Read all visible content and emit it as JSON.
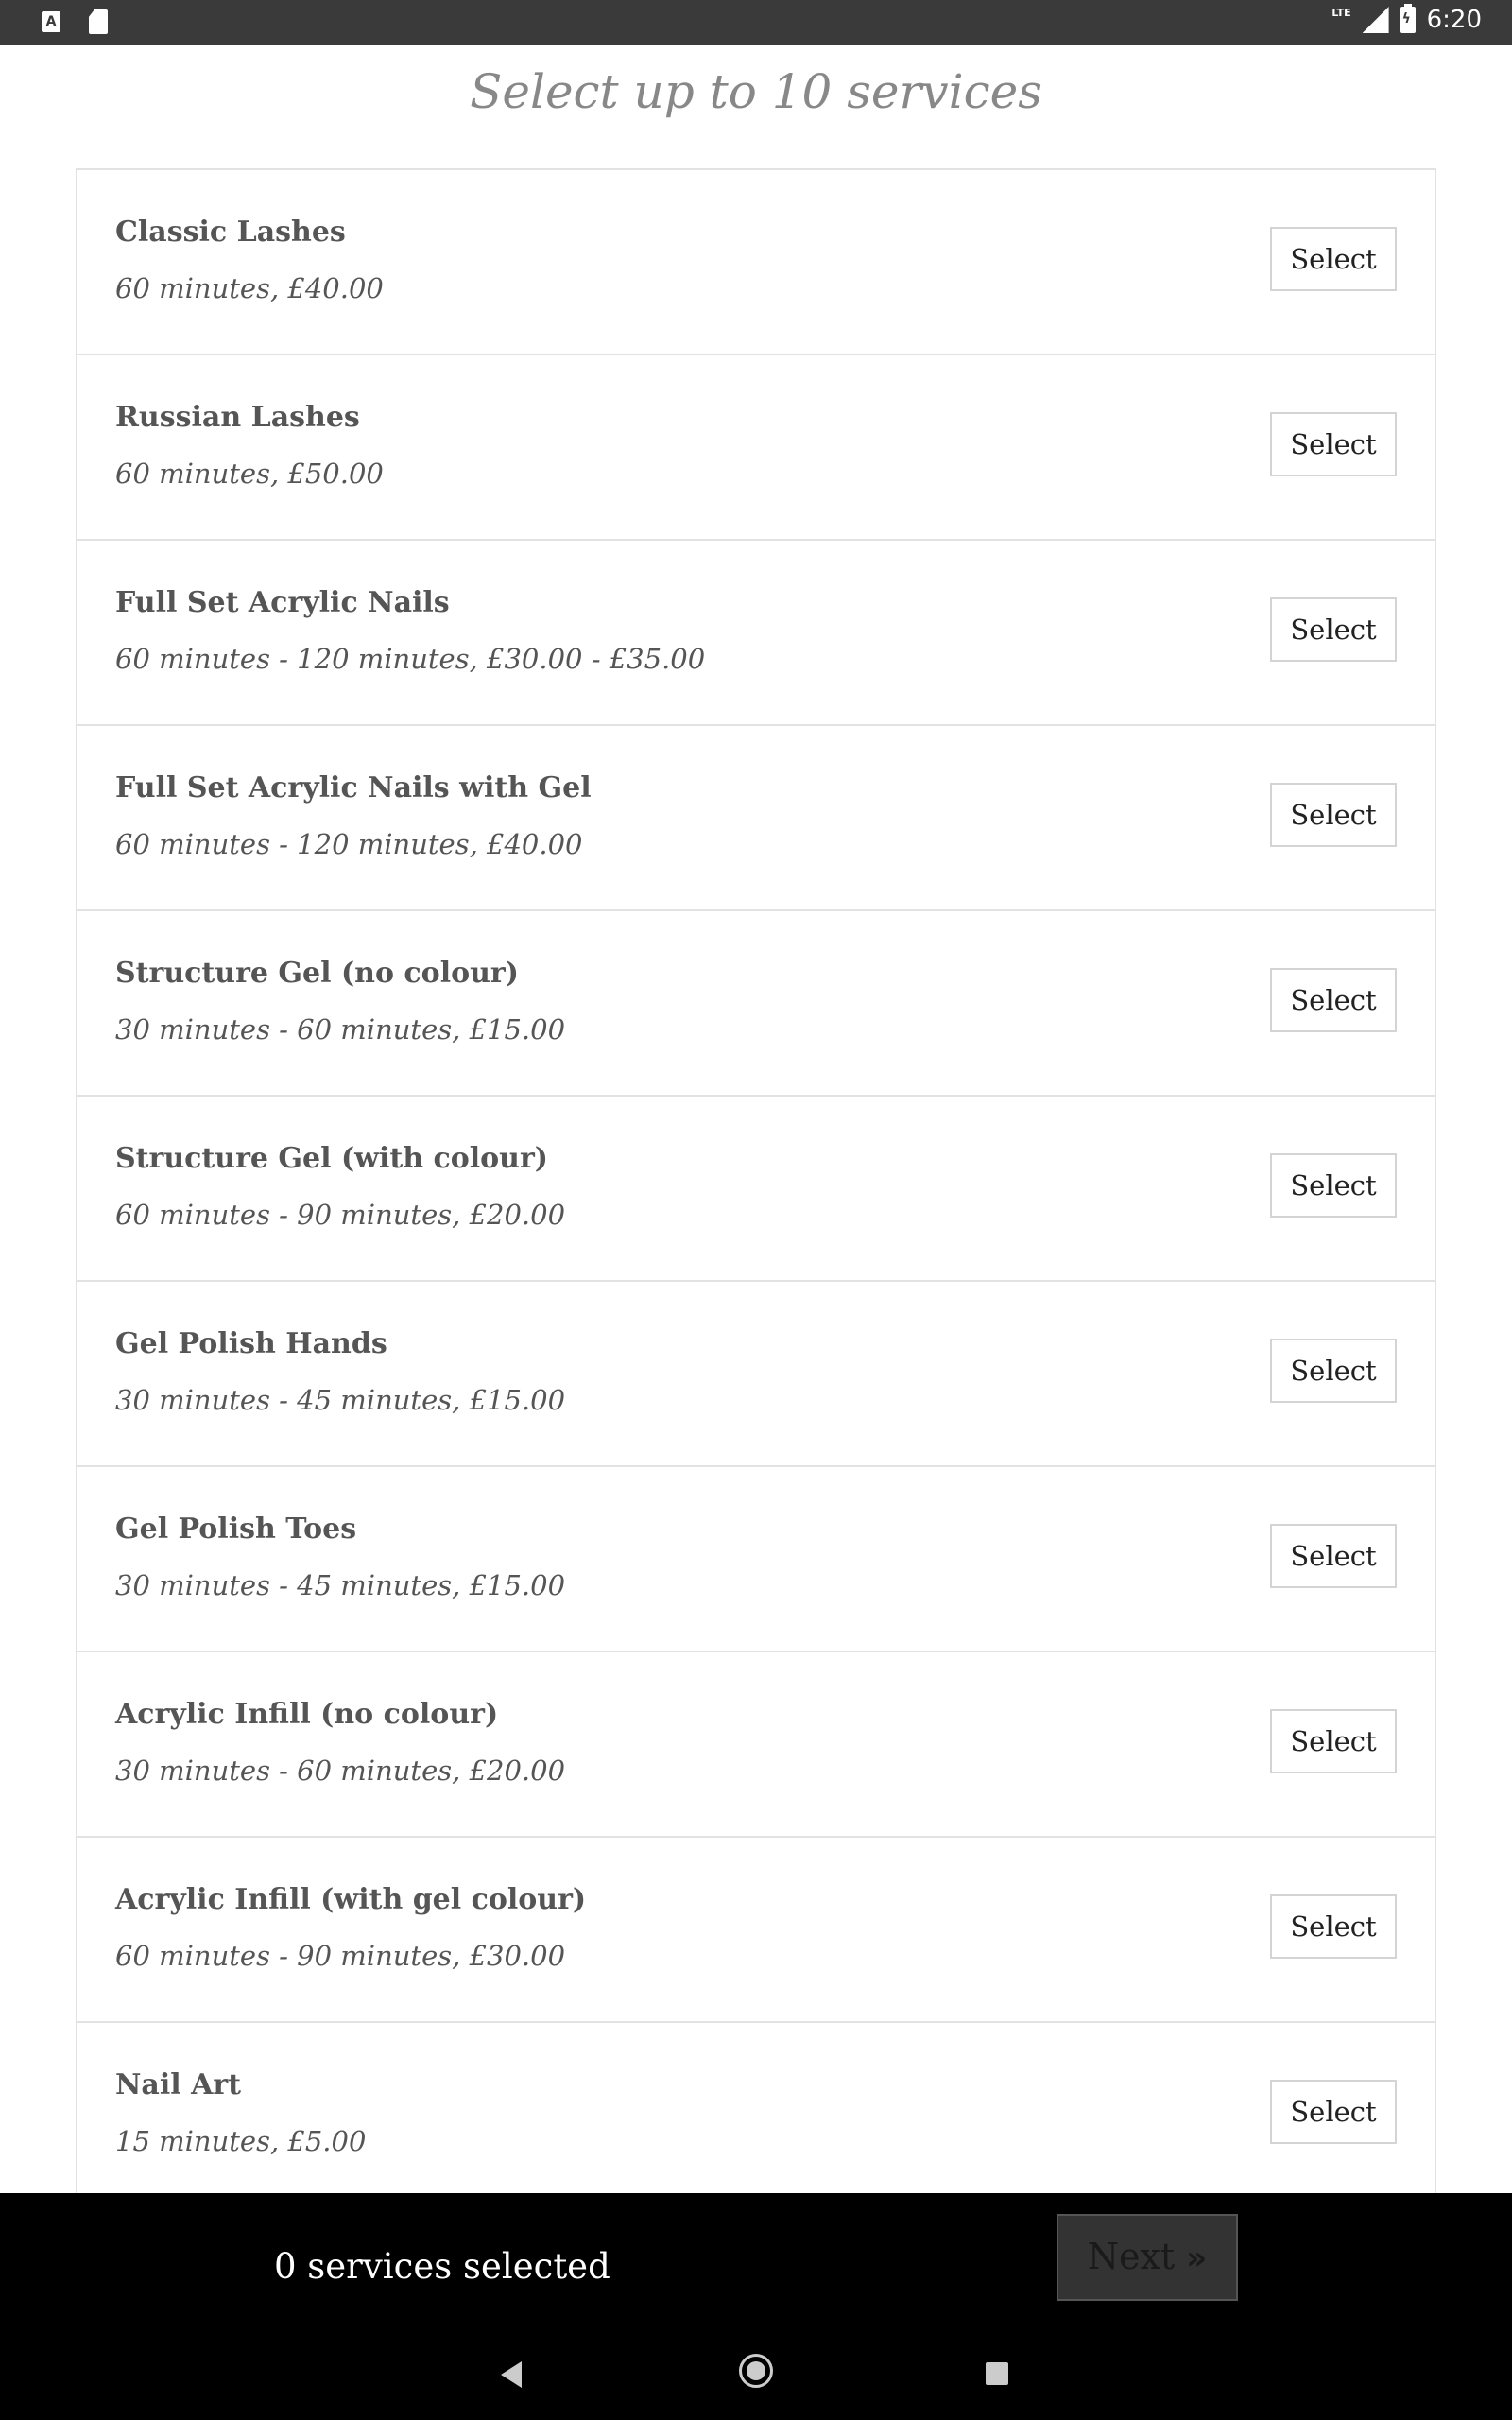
{
  "status_bar": {
    "notification_a": "A",
    "network_type": "LTE",
    "time": "6:20",
    "icons": [
      "notification-a-icon",
      "sd-card-icon",
      "signal-icon",
      "battery-charging-icon"
    ]
  },
  "page_title": "Select up to 10 services",
  "services": [
    {
      "name": "Classic Lashes",
      "detail": "60 minutes, £40.00",
      "button": "Select"
    },
    {
      "name": "Russian Lashes",
      "detail": "60 minutes, £50.00",
      "button": "Select"
    },
    {
      "name": "Full Set Acrylic Nails",
      "detail": "60 minutes - 120 minutes, £30.00 - £35.00",
      "button": "Select"
    },
    {
      "name": "Full Set Acrylic Nails with Gel",
      "detail": "60 minutes - 120 minutes, £40.00",
      "button": "Select"
    },
    {
      "name": "Structure Gel (no colour)",
      "detail": "30 minutes - 60 minutes, £15.00",
      "button": "Select"
    },
    {
      "name": "Structure Gel (with colour)",
      "detail": "60 minutes - 90 minutes, £20.00",
      "button": "Select"
    },
    {
      "name": "Gel Polish Hands",
      "detail": "30 minutes - 45 minutes, £15.00",
      "button": "Select"
    },
    {
      "name": "Gel Polish Toes",
      "detail": "30 minutes - 45 minutes, £15.00",
      "button": "Select"
    },
    {
      "name": "Acrylic Infill (no colour)",
      "detail": "30 minutes - 60 minutes, £20.00",
      "button": "Select"
    },
    {
      "name": "Acrylic Infill (with gel colour)",
      "detail": "60 minutes - 90 minutes, £30.00",
      "button": "Select"
    },
    {
      "name": "Nail Art",
      "detail": "15 minutes, £5.00",
      "button": "Select"
    }
  ],
  "footer": {
    "selected_count": "0 services selected",
    "next_label": "Next",
    "next_icon": "»"
  },
  "nav_bar": {
    "icons": [
      "back-icon",
      "home-icon",
      "recents-icon"
    ]
  },
  "colors": {
    "status_bar": "#3a3a3a",
    "title": "#888888",
    "text": "#555555",
    "border": "#e2e2e2",
    "footer": "#000000",
    "next_button": "#333333"
  }
}
